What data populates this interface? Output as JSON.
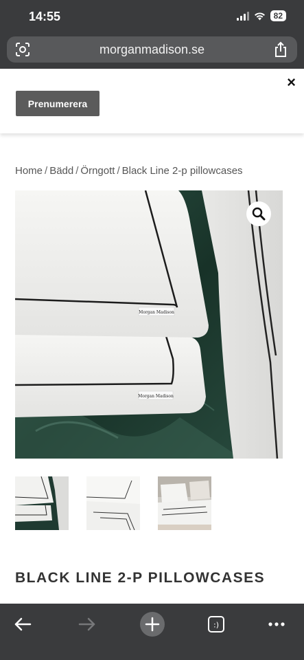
{
  "status_bar": {
    "time": "14:55",
    "battery": "82"
  },
  "browser": {
    "url": "morganmadison.se"
  },
  "banner": {
    "subscribe_label": "Prenumerera",
    "close_symbol": "×"
  },
  "breadcrumb": [
    "Home",
    "Bädd",
    "Örngott",
    "Black Line 2-p pillowcases"
  ],
  "product": {
    "title": "BLACK LINE 2-P PILLOWCASES",
    "label_text": "Morgan Madison",
    "thumbnail_count": 3
  },
  "colors": {
    "chrome": "#3a3b3d",
    "url_bar": "#58595b",
    "button": "#5b5b5b",
    "velvet": "#1f3a31"
  },
  "icons": [
    "reader-mode-icon",
    "share-icon",
    "close-icon",
    "zoom-icon",
    "back-arrow-icon",
    "forward-arrow-icon",
    "new-tab-icon",
    "tabs-icon",
    "more-icon"
  ]
}
